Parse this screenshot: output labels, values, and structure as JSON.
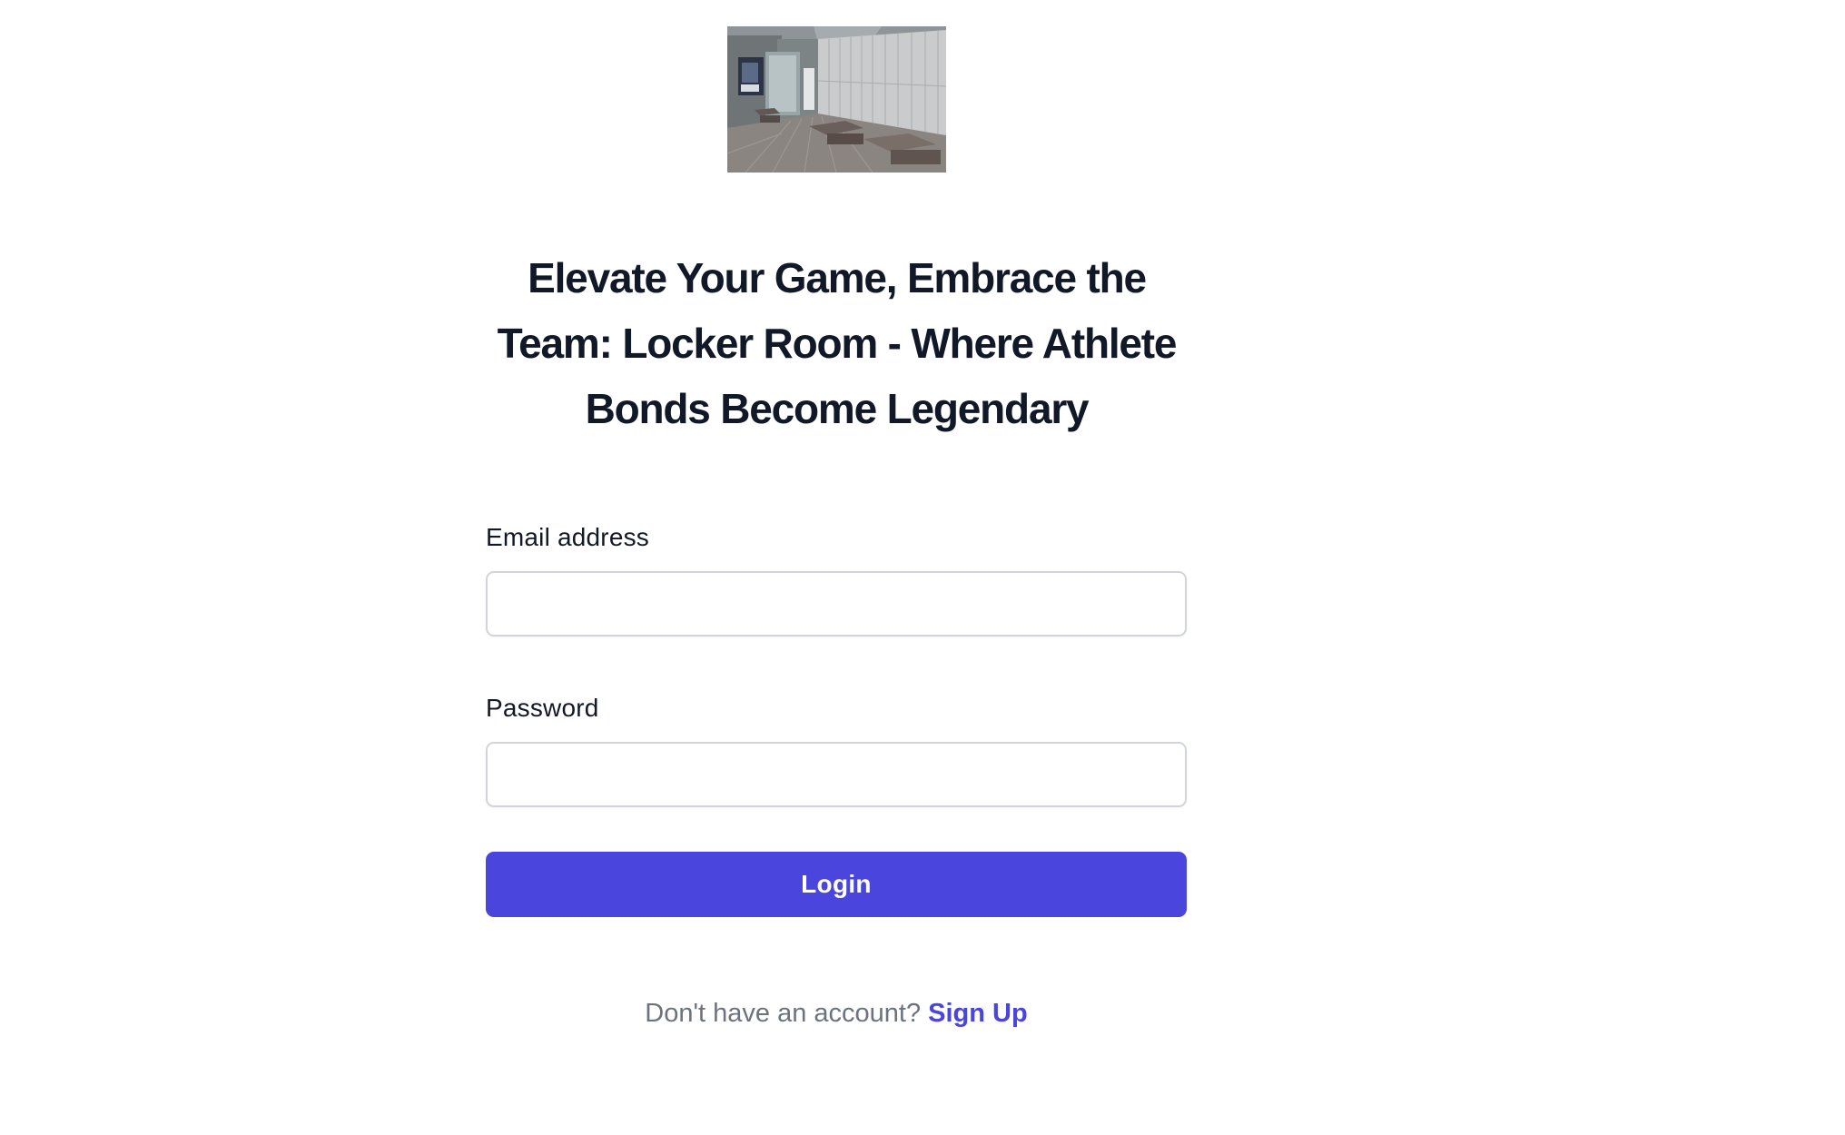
{
  "hero_image": {
    "icon": "locker-room-photo"
  },
  "headline": "Elevate Your Game, Embrace the Team: Locker Room - Where Athlete Bonds Become Legendary",
  "form": {
    "email_label": "Email address",
    "email_value": "",
    "password_label": "Password",
    "password_value": "",
    "login_label": "Login"
  },
  "signup": {
    "prompt": "Don't have an account?",
    "link_label": "Sign Up"
  },
  "colors": {
    "accent": "#4a46dd",
    "heading": "#111827",
    "muted": "#6b7280",
    "border": "#d1d5db"
  }
}
